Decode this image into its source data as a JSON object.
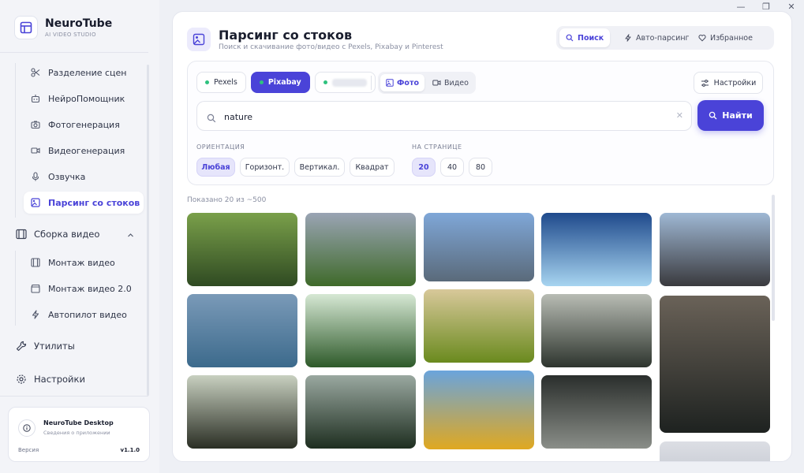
{
  "app": {
    "title": "NeuroTube",
    "subtitle": "AI VIDEO STUDIO"
  },
  "window": {
    "minimize": "—",
    "maximize": "❐",
    "close": "✕"
  },
  "sidebar": {
    "sub_items": [
      {
        "label": "Разделение сцен",
        "icon": "scissors-icon"
      },
      {
        "label": "НейроПомощник",
        "icon": "robot-icon"
      },
      {
        "label": "Фотогенерация",
        "icon": "camera-icon"
      },
      {
        "label": "Видеогенерация",
        "icon": "video-icon"
      },
      {
        "label": "Озвучка",
        "icon": "microphone-icon"
      },
      {
        "label": "Парсинг со стоков",
        "icon": "image-search-icon",
        "active": true
      }
    ],
    "group": {
      "label": "Сборка видео",
      "icon": "film-icon",
      "expanded": true
    },
    "group_items": [
      {
        "label": "Монтаж видео",
        "icon": "film-strip-icon"
      },
      {
        "label": "Монтаж видео 2.0",
        "icon": "clapper-icon"
      },
      {
        "label": "Автопилот видео",
        "icon": "lightning-icon"
      }
    ],
    "utilities": {
      "label": "Утилиты",
      "icon": "wrench-icon"
    },
    "settings": {
      "label": "Настройки",
      "icon": "gear-icon"
    },
    "about": {
      "title": "NeuroTube Desktop",
      "subtitle": "Сведения о приложении",
      "version_label": "Версия",
      "version_value": "v1.1.0"
    }
  },
  "header": {
    "title": "Парсинг со стоков",
    "subtitle": "Поиск и скачивание фото/видео с Pexels, Pixabay и Pinterest",
    "tabs": [
      {
        "label": "Поиск",
        "icon": "search-icon",
        "active": true
      },
      {
        "label": "Авто-парсинг",
        "icon": "lightning-icon"
      },
      {
        "label": "Избранное",
        "icon": "heart-icon"
      }
    ]
  },
  "filters": {
    "sources": [
      {
        "label": "Pexels",
        "active": false
      },
      {
        "label": "Pixabay",
        "active": true
      },
      {
        "label": "",
        "active": false,
        "blurred": true
      }
    ],
    "media": [
      {
        "label": "Фото",
        "active": true
      },
      {
        "label": "Видео",
        "active": false
      }
    ],
    "settings_label": "Настройки",
    "search": {
      "value": "nature",
      "placeholder": ""
    },
    "find_label": "Найти",
    "orientation_label": "ОРИЕНТАЦИЯ",
    "orientation": [
      {
        "label": "Любая",
        "active": true
      },
      {
        "label": "Горизонт.",
        "active": false
      },
      {
        "label": "Вертикал.",
        "active": false
      },
      {
        "label": "Квадрат",
        "active": false
      }
    ],
    "per_page_label": "НА СТРАНИЦЕ",
    "per_page": [
      {
        "label": "20",
        "active": true
      },
      {
        "label": "40",
        "active": false
      },
      {
        "label": "80",
        "active": false
      }
    ]
  },
  "results": {
    "shown_text": "Показано 20 из ~500",
    "images": [
      {
        "name": "tree-lake-photo",
        "c1": "#7aa04a",
        "c2": "#2f4a22"
      },
      {
        "name": "meadow-mountain-photo",
        "c1": "#9aa4b4",
        "c2": "#3f6a2a"
      },
      {
        "name": "alpine-lake-photo",
        "c1": "#7fa7d8",
        "c2": "#5a6a7a"
      },
      {
        "name": "iceberg-photo",
        "c1": "#1f4a8c",
        "c2": "#a7d4f0"
      },
      {
        "name": "hiker-mountains-photo",
        "c1": "#9fb8d4",
        "c2": "#3a3a3e"
      },
      {
        "name": "rainbow-lake-photo",
        "c1": "#7a9ab8",
        "c2": "#3c6a8c"
      },
      {
        "name": "dandelion-ladybug-photo",
        "c1": "#d6e8d4",
        "c2": "#2e5a2a"
      },
      {
        "name": "rice-terraces-photo",
        "c1": "#d8c89a",
        "c2": "#6a8a1e"
      },
      {
        "name": "misty-forest-photo",
        "c1": "#b8bcb4",
        "c2": "#2e352e"
      },
      {
        "name": "lynx-photo",
        "c1": "#6a6258",
        "c2": "#1e2220"
      },
      {
        "name": "forest-road-photo",
        "c1": "#c8d0c0",
        "c2": "#2a2e24"
      },
      {
        "name": "waterfall-photo",
        "c1": "#9aa8a0",
        "c2": "#1e2e20"
      },
      {
        "name": "golden-tree-photo",
        "c1": "#6aa4dc",
        "c2": "#e0a820"
      },
      {
        "name": "owl-photo",
        "c1": "#2a2e2c",
        "c2": "#8a8e88"
      },
      {
        "name": "partial-photo",
        "c1": "#dcdee4",
        "c2": "#c8ccd4"
      }
    ]
  }
}
